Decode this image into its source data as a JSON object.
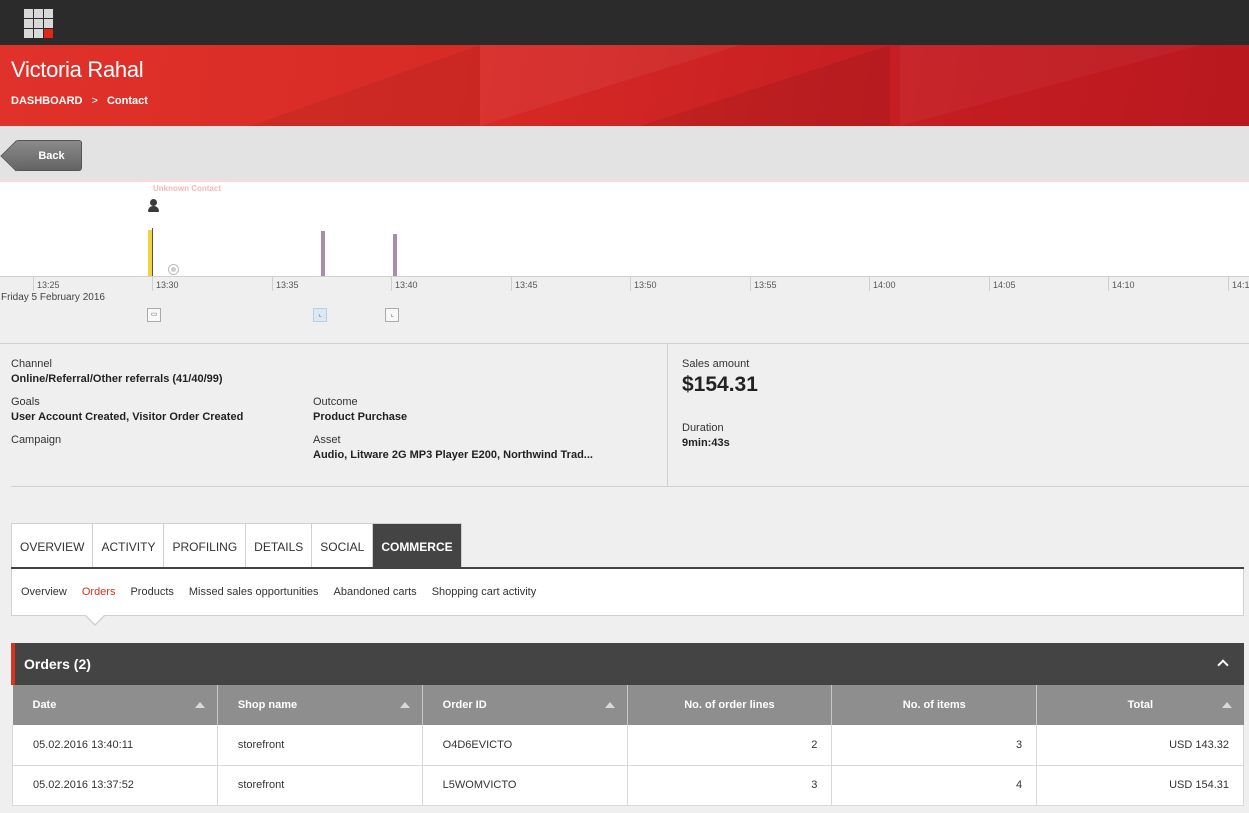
{
  "app": {
    "launcher_icon": "app-grid-icon"
  },
  "header": {
    "title": "Victoria Rahal",
    "breadcrumb": {
      "root": "DASHBOARD",
      "separator": ">",
      "current": "Contact"
    }
  },
  "toolbar": {
    "back_label": "Back"
  },
  "timeline": {
    "unknown_label": "Unknown Contact",
    "ticks": [
      "13:25",
      "13:30",
      "13:35",
      "13:40",
      "13:45",
      "13:50",
      "13:55",
      "14:00",
      "14:05",
      "14:10",
      "14:1"
    ],
    "date": "Friday 5 February 2016",
    "event_icons": [
      "page-event-icon",
      "chart-event-icon",
      "chart-event-icon"
    ]
  },
  "info": {
    "channel": {
      "label": "Channel",
      "value": "Online/Referral/Other referrals (41/40/99)"
    },
    "goals": {
      "label": "Goals",
      "value": "User Account Created, Visitor Order Created"
    },
    "outcome": {
      "label": "Outcome",
      "value": "Product Purchase"
    },
    "campaign": {
      "label": "Campaign",
      "value": ""
    },
    "asset": {
      "label": "Asset",
      "value": "Audio, Litware 2G MP3 Player E200, Northwind Trad..."
    },
    "sales_amount": {
      "label": "Sales amount",
      "value": "$154.31"
    },
    "duration": {
      "label": "Duration",
      "value": "9min:43s"
    }
  },
  "tabs": [
    "OVERVIEW",
    "ACTIVITY",
    "PROFILING",
    "DETAILS",
    "SOCIAL",
    "COMMERCE"
  ],
  "active_tab": "COMMERCE",
  "subtabs": [
    "Overview",
    "Orders",
    "Products",
    "Missed sales opportunities",
    "Abandoned carts",
    "Shopping cart activity"
  ],
  "active_subtab": "Orders",
  "orders": {
    "title": "Orders (2)",
    "columns": [
      "Date",
      "Shop name",
      "Order ID",
      "No. of order lines",
      "No. of items",
      "Total"
    ],
    "rows": [
      [
        "05.02.2016 13:40:11",
        "storefront",
        "O4D6EVICTO",
        "2",
        "3",
        "USD 143.32"
      ],
      [
        "05.02.2016 13:37:52",
        "storefront",
        "L5WOMVICTO",
        "3",
        "4",
        "USD 154.31"
      ]
    ]
  },
  "colors": {
    "accent": "#d9321e",
    "header_red": "#d92b26",
    "dark": "#444444",
    "topbar": "#2b2b2b"
  }
}
